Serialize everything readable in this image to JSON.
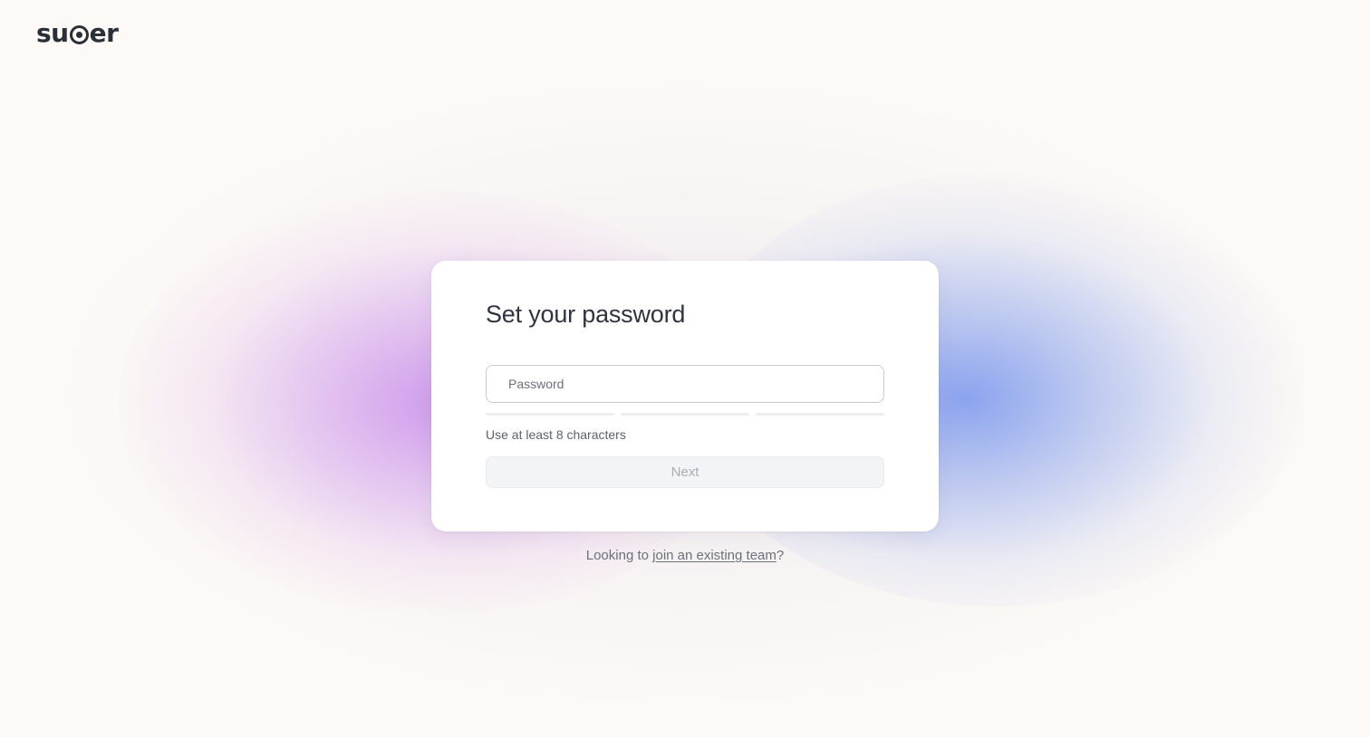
{
  "brand": {
    "logo_prefix": "su",
    "logo_suffix": "er"
  },
  "card": {
    "title": "Set your password",
    "password_placeholder": "Password",
    "password_value": "",
    "strength_segments": 3,
    "strength_filled": 0,
    "hint": "Use at least 8 characters",
    "next_label": "Next",
    "next_disabled": true
  },
  "footer": {
    "prefix": "Looking to ",
    "link_text": "join an existing team",
    "suffix": "?"
  },
  "colors": {
    "background": "#fdf9f6",
    "glow_purple": "#c88ceb",
    "glow_blue": "#7896ee",
    "text_primary": "#2f3540",
    "text_muted": "#6b7079"
  }
}
